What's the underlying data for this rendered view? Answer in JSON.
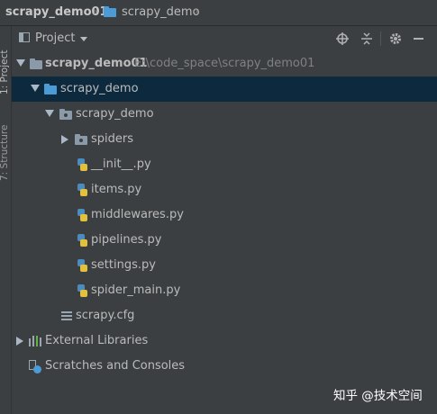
{
  "breadcrumb": {
    "project": "scrapy_demo01",
    "folder": "scrapy_demo"
  },
  "side_tabs": {
    "project": "1: Project",
    "structure": "7: Structure"
  },
  "panel": {
    "title": "Project"
  },
  "tree": {
    "root": {
      "label": "scrapy_demo01",
      "path": "E:\\code_space\\scrapy_demo01"
    },
    "outer_folder": "scrapy_demo",
    "package": "scrapy_demo",
    "spiders": "spiders",
    "files": [
      "__init__.py",
      "items.py",
      "middlewares.py",
      "pipelines.py",
      "settings.py",
      "spider_main.py"
    ],
    "cfg": "scrapy.cfg",
    "external_libraries": "External Libraries",
    "scratches": "Scratches and Consoles"
  },
  "watermark": "知乎 @技术空间",
  "colors": {
    "background": "#3c3f41",
    "selection": "#0d293e",
    "folder_blue": "#4a9bd6",
    "text": "#bbbbbb"
  }
}
